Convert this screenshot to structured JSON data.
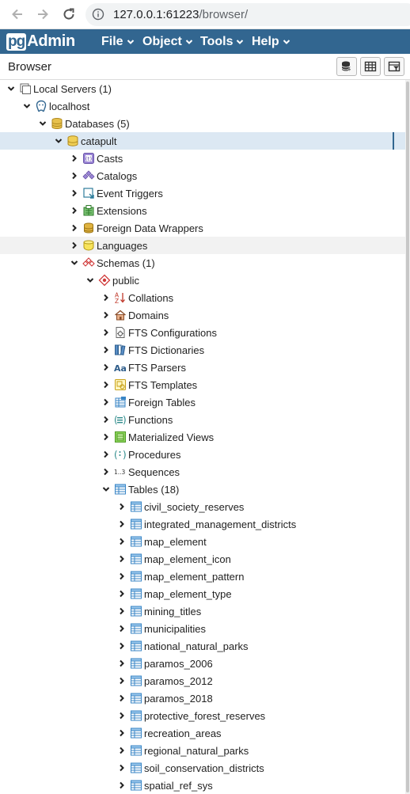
{
  "browser": {
    "url_host": "127.0.0.1:61223",
    "url_path": "/browser/"
  },
  "navbar": {
    "brand_pg": "pg",
    "brand_admin": "Admin",
    "menus": [
      "File",
      "Object",
      "Tools",
      "Help"
    ]
  },
  "panel": {
    "title": "Browser"
  },
  "tree": [
    {
      "label": "Local Servers (1)",
      "icon": "servers-icon",
      "toggle": "open"
    },
    {
      "label": "localhost",
      "icon": "postgres-server-icon",
      "toggle": "open"
    },
    {
      "label": "Databases (5)",
      "icon": "databases-icon",
      "toggle": "open"
    },
    {
      "label": "catapult",
      "icon": "database-icon",
      "toggle": "open",
      "state": "selected"
    },
    {
      "label": "Casts",
      "icon": "casts-icon",
      "toggle": "closed"
    },
    {
      "label": "Catalogs",
      "icon": "catalogs-icon",
      "toggle": "closed"
    },
    {
      "label": "Event Triggers",
      "icon": "event-triggers-icon",
      "toggle": "closed"
    },
    {
      "label": "Extensions",
      "icon": "extensions-icon",
      "toggle": "closed"
    },
    {
      "label": "Foreign Data Wrappers",
      "icon": "foreign-data-wrappers-icon",
      "toggle": "closed"
    },
    {
      "label": "Languages",
      "icon": "languages-icon",
      "toggle": "closed",
      "state": "hovered"
    },
    {
      "label": "Schemas (1)",
      "icon": "schemas-icon",
      "toggle": "open"
    },
    {
      "label": "public",
      "icon": "schema-icon",
      "toggle": "open"
    },
    {
      "label": "Collations",
      "icon": "collations-icon",
      "toggle": "closed"
    },
    {
      "label": "Domains",
      "icon": "domains-icon",
      "toggle": "closed"
    },
    {
      "label": "FTS Configurations",
      "icon": "fts-configurations-icon",
      "toggle": "closed"
    },
    {
      "label": "FTS Dictionaries",
      "icon": "fts-dictionaries-icon",
      "toggle": "closed"
    },
    {
      "label": "FTS Parsers",
      "icon": "fts-parsers-icon",
      "toggle": "closed"
    },
    {
      "label": "FTS Templates",
      "icon": "fts-templates-icon",
      "toggle": "closed"
    },
    {
      "label": "Foreign Tables",
      "icon": "foreign-tables-icon",
      "toggle": "closed"
    },
    {
      "label": "Functions",
      "icon": "functions-icon",
      "toggle": "closed"
    },
    {
      "label": "Materialized Views",
      "icon": "materialized-views-icon",
      "toggle": "closed"
    },
    {
      "label": "Procedures",
      "icon": "procedures-icon",
      "toggle": "closed"
    },
    {
      "label": "Sequences",
      "icon": "sequences-icon",
      "toggle": "closed"
    },
    {
      "label": "Tables (18)",
      "icon": "tables-icon",
      "toggle": "open"
    },
    {
      "label": "civil_society_reserves",
      "icon": "table-icon",
      "toggle": "closed"
    },
    {
      "label": "integrated_management_districts",
      "icon": "table-icon",
      "toggle": "closed"
    },
    {
      "label": "map_element",
      "icon": "table-icon",
      "toggle": "closed"
    },
    {
      "label": "map_element_icon",
      "icon": "table-icon",
      "toggle": "closed"
    },
    {
      "label": "map_element_pattern",
      "icon": "table-icon",
      "toggle": "closed"
    },
    {
      "label": "map_element_type",
      "icon": "table-icon",
      "toggle": "closed"
    },
    {
      "label": "mining_titles",
      "icon": "table-icon",
      "toggle": "closed"
    },
    {
      "label": "municipalities",
      "icon": "table-icon",
      "toggle": "closed"
    },
    {
      "label": "national_natural_parks",
      "icon": "table-icon",
      "toggle": "closed"
    },
    {
      "label": "paramos_2006",
      "icon": "table-icon",
      "toggle": "closed"
    },
    {
      "label": "paramos_2012",
      "icon": "table-icon",
      "toggle": "closed"
    },
    {
      "label": "paramos_2018",
      "icon": "table-icon",
      "toggle": "closed"
    },
    {
      "label": "protective_forest_reserves",
      "icon": "table-icon",
      "toggle": "closed"
    },
    {
      "label": "recreation_areas",
      "icon": "table-icon",
      "toggle": "closed"
    },
    {
      "label": "regional_natural_parks",
      "icon": "table-icon",
      "toggle": "closed"
    },
    {
      "label": "soil_conservation_districts",
      "icon": "table-icon",
      "toggle": "closed"
    },
    {
      "label": "spatial_ref_sys",
      "icon": "table-icon",
      "toggle": "closed"
    }
  ],
  "colors": {
    "navbar": "#326690",
    "selected_row": "#dce8f3",
    "hovered_row": "#f2f2f2"
  }
}
